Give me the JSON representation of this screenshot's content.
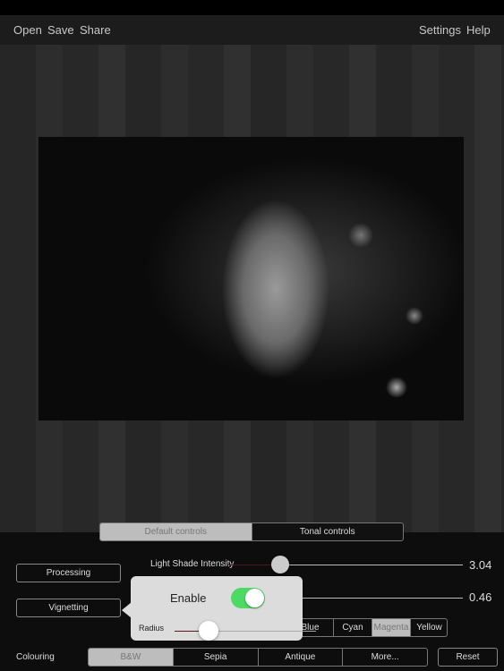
{
  "toolbar": {
    "open": "Open",
    "save": "Save",
    "share": "Share",
    "settings": "Settings",
    "help": "Help"
  },
  "tabs": {
    "default": "Default controls",
    "tonal": "Tonal controls",
    "selected": "Default controls"
  },
  "buttons": {
    "processing": "Processing",
    "vignetting": "Vignetting",
    "reset": "Reset"
  },
  "sliders": {
    "light_shade": {
      "label": "Light Shade Intensity",
      "value": "3.04"
    },
    "second": {
      "value": "0.46"
    }
  },
  "colours": [
    "Blue",
    "Cyan",
    "Magenta",
    "Yellow"
  ],
  "colour_selected": "Magenta",
  "colouring": {
    "label": "Colouring",
    "options": [
      "B&W",
      "Sepia",
      "Antique",
      "More..."
    ],
    "selected": "B&W"
  },
  "popover": {
    "enable_label": "Enable",
    "enabled": true,
    "radius_label": "Radius",
    "toggle_color": "#4cd964"
  }
}
